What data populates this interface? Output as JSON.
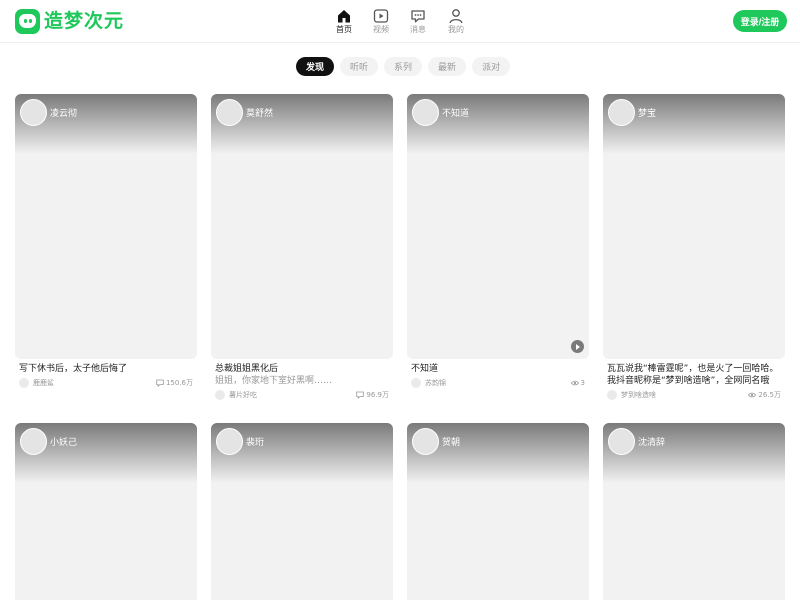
{
  "header": {
    "logo_text": "造梦次元",
    "nav": [
      {
        "label": "首页",
        "icon": "home-icon",
        "active": true
      },
      {
        "label": "视频",
        "icon": "video-icon",
        "active": false
      },
      {
        "label": "消息",
        "icon": "message-icon",
        "active": false
      },
      {
        "label": "我的",
        "icon": "user-icon",
        "active": false
      }
    ],
    "login_label": "登录/注册"
  },
  "tabs": [
    {
      "label": "发现",
      "active": true
    },
    {
      "label": "听听",
      "active": false
    },
    {
      "label": "系列",
      "active": false
    },
    {
      "label": "最新",
      "active": false
    },
    {
      "label": "派对",
      "active": false
    }
  ],
  "cards": [
    {
      "author": "凌云彻",
      "title": "写下休书后，太子他后悔了",
      "desc": "",
      "user": "鹿鹿鲨",
      "stat_icon": "chat-icon",
      "stat": "150.6万"
    },
    {
      "author": "莫舒然",
      "title": "总裁姐姐黑化后",
      "desc": "姐姐，你家地下室好黑啊……",
      "user": "薯片好吃",
      "stat_icon": "chat-icon",
      "stat": "96.9万"
    },
    {
      "author": "不知道",
      "title": "不知道",
      "desc": "",
      "user": "苏韵锦",
      "stat_icon": "eye-icon",
      "stat": "3",
      "has_play": true
    },
    {
      "author": "梦宝",
      "title": "瓦瓦说我“棒雷霆呢”，也是火了一回哈哈。我抖音昵称是“梦到啥造啥”，全网同名哦",
      "desc": "",
      "user": "梦到啥造啥",
      "stat_icon": "eye-icon",
      "stat": "26.5万"
    },
    {
      "author": "小妖己"
    },
    {
      "author": "裴珩"
    },
    {
      "author": "贺朝"
    },
    {
      "author": "沈清辞"
    }
  ],
  "colors": {
    "brand": "#1fc85a",
    "active_tab": "#111111"
  }
}
